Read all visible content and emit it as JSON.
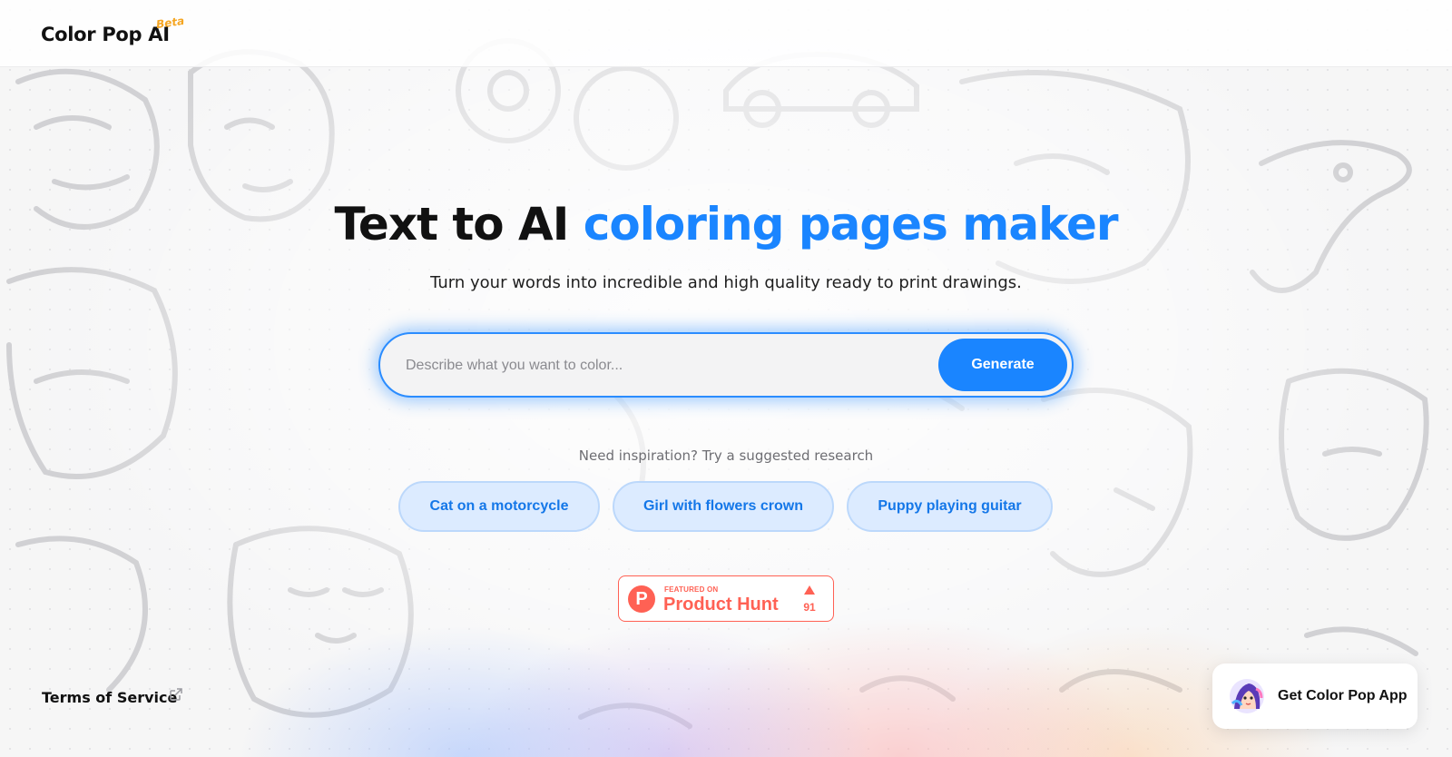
{
  "header": {
    "logo_text": "Color Pop AI",
    "beta_badge": "Beta"
  },
  "hero": {
    "title_plain": "Text to AI",
    "title_accent": "coloring pages maker",
    "subtitle": "Turn your words into incredible and high quality ready to print drawings."
  },
  "search": {
    "placeholder": "Describe what you want to color...",
    "value": "",
    "button_label": "Generate"
  },
  "suggestions": {
    "heading": "Need inspiration? Try a suggested research",
    "items": [
      {
        "label": "Cat on a motorcycle"
      },
      {
        "label": "Girl with flowers crown"
      },
      {
        "label": "Puppy playing guitar"
      }
    ]
  },
  "product_hunt": {
    "featured_label": "FEATURED ON",
    "name": "Product Hunt",
    "logo_letter": "P",
    "votes": "91",
    "color": "#ff6154"
  },
  "footer": {
    "terms_label": "Terms of Service",
    "app_cta_label": "Get Color Pop App"
  },
  "theme": {
    "accent": "#1a85ff",
    "chip_background": "#dcebff",
    "beta_color": "#f5a623"
  }
}
